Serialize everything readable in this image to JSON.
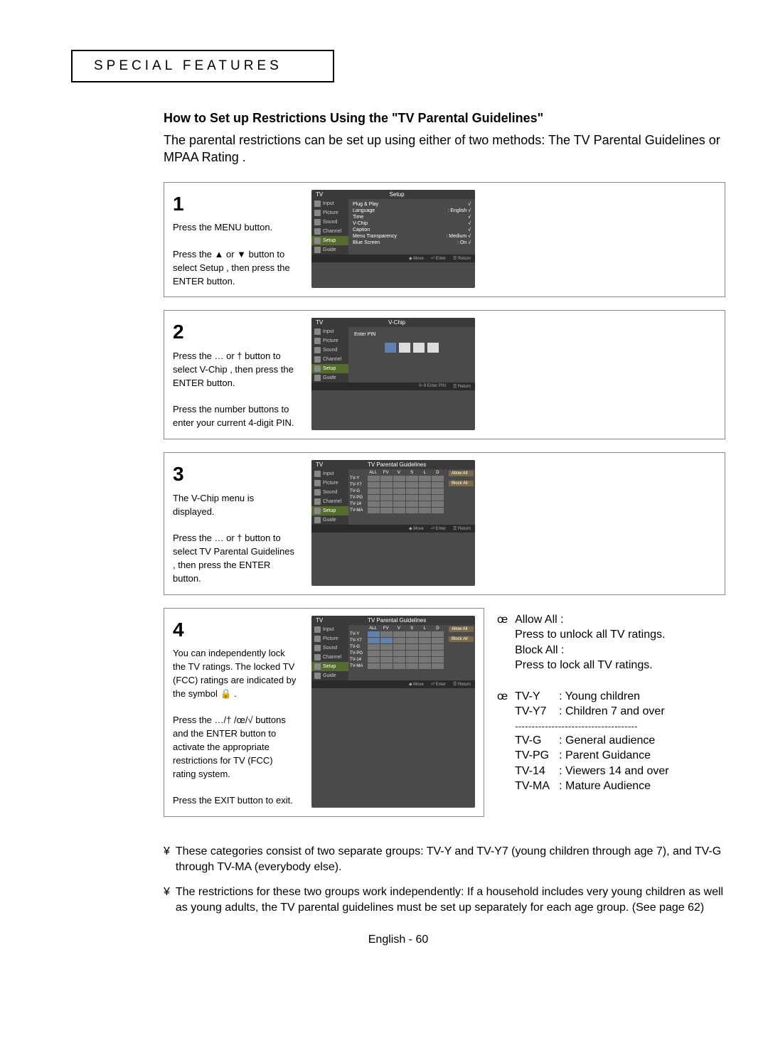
{
  "section_title": "SPECIAL FEATURES",
  "main_heading": "How to Set up Restrictions Using the \"TV Parental Guidelines\"",
  "intro": "The parental restrictions can be set up using either of two methods: The  TV Parental Guidelines  or  MPAA Rating .",
  "steps": {
    "s1": {
      "num": "1",
      "text1": "Press the MENU button.",
      "text2": "Press the ▲ or ▼ button to select  Setup , then press the ENTER button."
    },
    "s2": {
      "num": "2",
      "text": "Press the … or † button to select  V-Chip , then press the ENTER button.",
      "text2": "Press the number buttons to enter your current 4-digit PIN."
    },
    "s3": {
      "num": "3",
      "text": "The  V-Chip  menu is displayed.",
      "text2": "Press the … or † button to select  TV Parental Guidelines , then press the ENTER button."
    },
    "s4": {
      "num": "4",
      "text": "You can independently lock the TV ratings. The locked TV (FCC) ratings are indicated by the symbol 🔒 .",
      "text2": "Press the …/† /œ/√ buttons and the ENTER button to activate the appropriate restrictions for TV (FCC) rating system.",
      "text3": "Press the EXIT button to exit."
    }
  },
  "osd": {
    "tv_label": "TV",
    "sidebar": [
      "Input",
      "Picture",
      "Sound",
      "Channel",
      "Setup",
      "Guide"
    ],
    "setup_title": "Setup",
    "setup_items": [
      {
        "l": "Plug & Play",
        "r": "√"
      },
      {
        "l": "Language",
        "r": ": English     √"
      },
      {
        "l": "Time",
        "r": "√"
      },
      {
        "l": "V-Chip",
        "r": "√"
      },
      {
        "l": "Caption",
        "r": "√"
      },
      {
        "l": "Menu Transparency",
        "r": ": Medium      √"
      },
      {
        "l": "Blue Screen",
        "r": ": On              √"
      }
    ],
    "vchip_title": "V-Chip",
    "enter_pin": "Enter PIN",
    "pg_title": "TV Parental Guidelines",
    "grid_cols": [
      "ALL",
      "FV",
      "V",
      "S",
      "L",
      "D"
    ],
    "grid_rows": [
      "TV-Y",
      "TV-Y7",
      "TV-G",
      "TV-PG",
      "TV-14",
      "TV-MA"
    ],
    "allow_all": "Allow All",
    "block_all": "Block All",
    "footer_move": "◆ Move",
    "footer_enter": "⏎ Enter",
    "footer_return": "☰ Return",
    "footer_pin": "0~9  Enter PIN"
  },
  "legend": {
    "allow_all_label": "Allow All :",
    "allow_all_text": "Press to unlock all TV ratings.",
    "block_all_label": "Block All :",
    "block_all_text": "Press to lock all TV ratings.",
    "bullet": "œ",
    "ratings1": [
      {
        "code": "TV-Y",
        "desc": ": Young children"
      },
      {
        "code": "TV-Y7",
        "desc": ": Children 7 and over"
      }
    ],
    "divider": "-------------------------------------",
    "ratings2": [
      {
        "code": "TV-G",
        "desc": ": General audience"
      },
      {
        "code": "TV-PG",
        "desc": ": Parent Guidance"
      },
      {
        "code": "TV-14",
        "desc": ": Viewers 14 and over"
      },
      {
        "code": "TV-MA",
        "desc": ": Mature Audience"
      }
    ]
  },
  "notes": {
    "bullet": "¥",
    "note1": "These categories consist of two separate groups:  TV-Y  and  TV-Y7  (young children through age 7), and  TV-G  through  TV-MA  (everybody else).",
    "note2": "The restrictions for these two groups work independently: If a household includes very young children as well as young adults, the TV parental guidelines must be set up separately for each age group. (See page 62)"
  },
  "footer": "English - 60"
}
